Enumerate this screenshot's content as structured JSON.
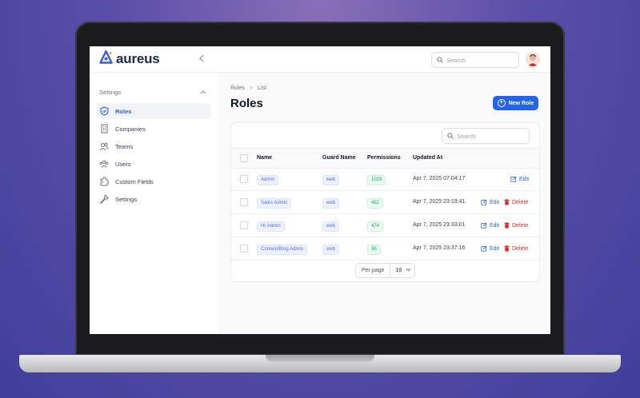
{
  "app": {
    "brand": "aureus"
  },
  "topbar": {
    "search_placeholder": "Search"
  },
  "sidebar": {
    "group_label": "Settings",
    "items": [
      {
        "label": "Roles",
        "icon": "shield-check-icon",
        "active": true
      },
      {
        "label": "Companies",
        "icon": "building-icon",
        "active": false
      },
      {
        "label": "Teams",
        "icon": "users-icon",
        "active": false
      },
      {
        "label": "Users",
        "icon": "user-group-icon",
        "active": false
      },
      {
        "label": "Custom Fields",
        "icon": "puzzle-icon",
        "active": false
      },
      {
        "label": "Settings",
        "icon": "wrench-icon",
        "active": false
      }
    ]
  },
  "breadcrumb": {
    "parent": "Roles",
    "current": "List"
  },
  "page": {
    "title": "Roles",
    "new_button": "New Role"
  },
  "table": {
    "search_placeholder": "Search",
    "columns": [
      "Name",
      "Guard Name",
      "Permissions",
      "Updated At"
    ],
    "edit_label": "Edit",
    "delete_label": "Delete",
    "rows": [
      {
        "name": "Admin",
        "guard": "web",
        "permissions": "1029",
        "updated": "Apr 7, 2025 07:04:17",
        "deletable": false
      },
      {
        "name": "Sales Admin",
        "guard": "web",
        "permissions": "482",
        "updated": "Apr 7, 2025 23:19:41",
        "deletable": true
      },
      {
        "name": "Hr Admin",
        "guard": "web",
        "permissions": "474",
        "updated": "Apr 7, 2025 23:33:01",
        "deletable": true
      },
      {
        "name": "Content/Blog Admin",
        "guard": "web",
        "permissions": "36",
        "updated": "Apr 7, 2025 23:37:16",
        "deletable": true
      }
    ]
  },
  "pagination": {
    "per_page_label": "Per page",
    "per_page_value": "10"
  },
  "colors": {
    "accent": "#2563eb",
    "danger": "#dc2626",
    "success": "#16a34a"
  }
}
